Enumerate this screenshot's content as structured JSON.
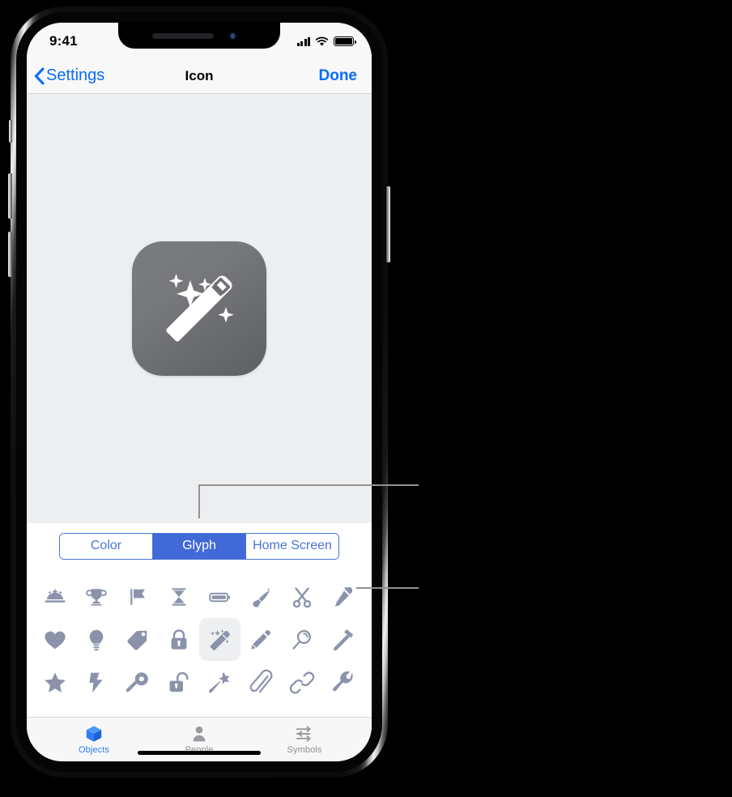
{
  "device": {
    "name": "iphone-x-frame",
    "status_bar": {
      "time": "9:41",
      "cellular_icon": "signal-bars-icon",
      "wifi_icon": "wifi-icon",
      "battery_icon": "battery-full-icon"
    }
  },
  "nav_bar": {
    "back_label": "Settings",
    "back_icon": "chevron-left-icon",
    "title": "Icon",
    "done_label": "Done",
    "tint_color": "#0a6cff"
  },
  "preview": {
    "icon_name": "app-icon-magic-wand",
    "icon_glyph": "magic-wand-sparkles",
    "background_color": "#eceef0",
    "icon_gradient_from": "#7a7c80",
    "icon_gradient_to": "#5d5f64",
    "glyph_color": "#ffffff"
  },
  "segmented_control": {
    "selected_index": 1,
    "accent_color": "#4169d8",
    "segments": [
      {
        "label": "Color"
      },
      {
        "label": "Glyph"
      },
      {
        "label": "Home Screen"
      }
    ]
  },
  "glyph_grid": {
    "glyph_color": "#8b93ab",
    "selected_background": "#eeeff1",
    "selected_index": 12,
    "glyphs": [
      {
        "name": "food-dome-sparkles-icon",
        "label": "Food Dome"
      },
      {
        "name": "trophy-icon",
        "label": "Trophy"
      },
      {
        "name": "flag-icon",
        "label": "Flag"
      },
      {
        "name": "hourglass-icon",
        "label": "Hourglass"
      },
      {
        "name": "battery-icon",
        "label": "Battery"
      },
      {
        "name": "paintbrush-icon",
        "label": "Paintbrush"
      },
      {
        "name": "scissors-icon",
        "label": "Scissors"
      },
      {
        "name": "eyedropper-icon",
        "label": "Eyedropper"
      },
      {
        "name": "heart-icon",
        "label": "Heart"
      },
      {
        "name": "lightbulb-icon",
        "label": "Lightbulb"
      },
      {
        "name": "tag-icon",
        "label": "Tag"
      },
      {
        "name": "lock-closed-icon",
        "label": "Lock"
      },
      {
        "name": "magic-wand-icon",
        "label": "Magic Wand"
      },
      {
        "name": "pencil-icon",
        "label": "Pencil"
      },
      {
        "name": "magnifier-icon",
        "label": "Magnifier"
      },
      {
        "name": "hammer-icon",
        "label": "Hammer"
      },
      {
        "name": "star-icon",
        "label": "Star"
      },
      {
        "name": "lightning-bolt-icon",
        "label": "Bolt"
      },
      {
        "name": "key-icon",
        "label": "Key"
      },
      {
        "name": "lock-open-icon",
        "label": "Unlocked Lock"
      },
      {
        "name": "wand-star-icon",
        "label": "Wand with Star"
      },
      {
        "name": "paperclip-icon",
        "label": "Paperclip"
      },
      {
        "name": "link-icon",
        "label": "Link"
      },
      {
        "name": "wrench-icon",
        "label": "Wrench"
      }
    ]
  },
  "tab_bar": {
    "active_index": 0,
    "active_color": "#2f7cf6",
    "inactive_color": "#8e8e93",
    "tabs": [
      {
        "label": "Objects",
        "icon": "cube-icon"
      },
      {
        "label": "People",
        "icon": "person-icon"
      },
      {
        "label": "Symbols",
        "icon": "sliders-icon"
      }
    ]
  },
  "callouts": {
    "line_color": "#929292",
    "items": [
      {
        "name": "callout-segmented-control",
        "target": "Glyph segment"
      },
      {
        "name": "callout-glyph-eyedropper",
        "target": "Eyedropper glyph"
      }
    ]
  }
}
